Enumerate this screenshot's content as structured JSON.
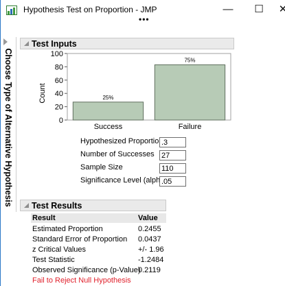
{
  "window": {
    "title": "Hypothesis Test on Proportion - JMP",
    "minimize": "—",
    "maximize": "☐",
    "close": "✕",
    "more": "•••"
  },
  "side_tab": {
    "label": "Choose Type of Alternative Hypothesis"
  },
  "test_inputs": {
    "header": "Test Inputs",
    "chart_data": {
      "type": "bar",
      "categories": [
        "Success",
        "Failure"
      ],
      "values": [
        27,
        83
      ],
      "data_labels": [
        "25%",
        "75%"
      ],
      "ylabel": "Count",
      "ylim": [
        0,
        100
      ],
      "yticks": [
        0,
        20,
        40,
        60,
        80,
        100
      ],
      "ytick_labels": [
        "0",
        "20",
        "40",
        "60",
        "80",
        "100"
      ],
      "bar_color": "#b7cbb6",
      "bar_edge": "#5f6f5e",
      "grid": false
    },
    "fields": [
      {
        "label": "Hypothesized Proportion",
        "value": ".3"
      },
      {
        "label": "Number of Successes",
        "value": "27"
      },
      {
        "label": "Sample Size",
        "value": "110"
      },
      {
        "label": "Significance Level (alpha)",
        "value": ".05"
      }
    ]
  },
  "test_results": {
    "header": "Test Results",
    "columns": [
      "Result",
      "Value"
    ],
    "rows": [
      [
        "Estimated Proportion",
        "0.2455"
      ],
      [
        "Standard Error of Proportion",
        "0.0437"
      ],
      [
        "z Critical Values",
        "+/- 1.96"
      ],
      [
        "Test Statistic",
        "-1.2484"
      ],
      [
        "Observed Significance (p-Value)",
        "0.2119"
      ]
    ],
    "conclusion": "Fail to Reject Null Hypothesis",
    "conclusion_color": "#e0202b"
  }
}
